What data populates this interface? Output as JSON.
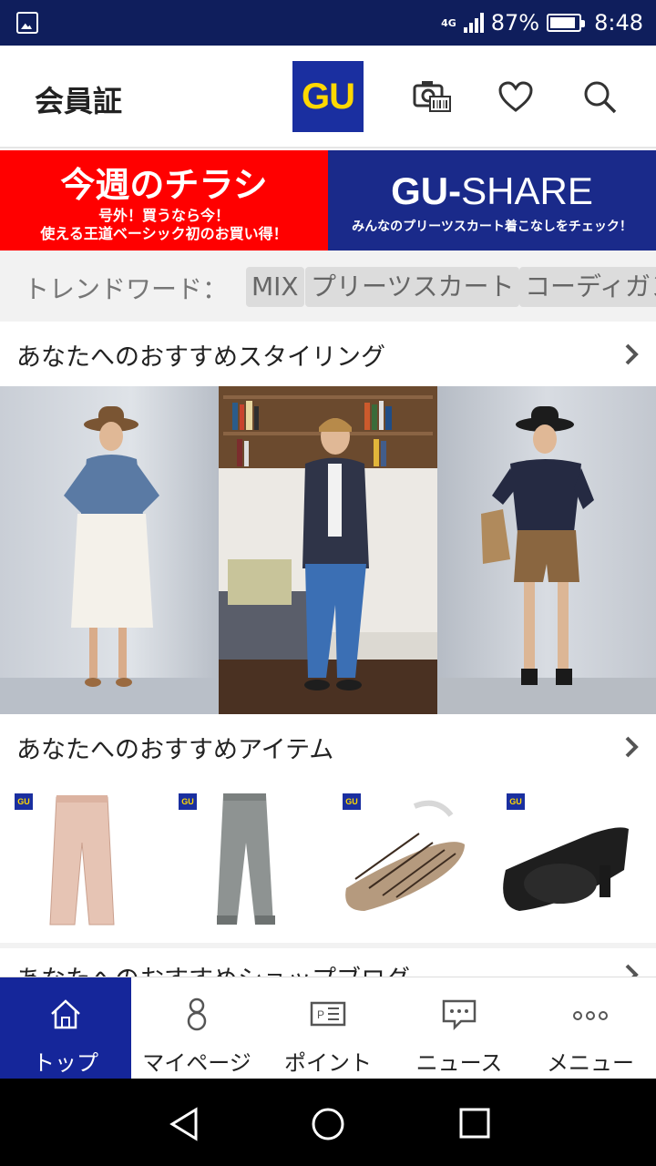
{
  "status_bar": {
    "network": "4G",
    "battery": "87%",
    "time": "8:48"
  },
  "header": {
    "member_card": "会員証",
    "logo": "GU",
    "icons": [
      "camera-barcode-icon",
      "heart-icon",
      "search-icon"
    ]
  },
  "banners": {
    "flyer": {
      "title": "今週のチラシ",
      "line1": "号外！買うなら今！",
      "line2": "使える王道ベーシック初のお買い得！"
    },
    "share": {
      "title_bold": "GU-",
      "title_light": "SHARE",
      "subtitle": "みんなのプリーツスカート着こなしをチェック！"
    }
  },
  "trend": {
    "label": "トレンドワード：",
    "words": [
      "MIX",
      "プリーツスカート",
      "コーディガン"
    ]
  },
  "sections": {
    "styling_title": "あなたへのおすすめスタイリング",
    "items_title": "あなたへのおすすめアイテム",
    "blog_title": "あなたへのおすすめショップブログ"
  },
  "items": [
    {
      "name": "wide-pants-pink",
      "badge": "GU"
    },
    {
      "name": "jogger-pants-gray",
      "badge": "GU"
    },
    {
      "name": "lace-up-flats-python",
      "badge": "GU"
    },
    {
      "name": "fur-pumps-black",
      "badge": "GU"
    }
  ],
  "bottom_nav": [
    {
      "label": "トップ",
      "icon": "home-icon"
    },
    {
      "label": "マイページ",
      "icon": "person-icon"
    },
    {
      "label": "ポイント",
      "icon": "point-card-icon"
    },
    {
      "label": "ニュース",
      "icon": "chat-bubble-icon"
    },
    {
      "label": "メニュー",
      "icon": "more-dots-icon"
    }
  ],
  "colors": {
    "status_bar": "#0f1e5c",
    "brand_blue": "#1a2fa0",
    "brand_yellow": "#ffd800",
    "flyer_red": "#ff0000",
    "share_blue": "#1a2a8a",
    "nav_active": "#15269a"
  }
}
